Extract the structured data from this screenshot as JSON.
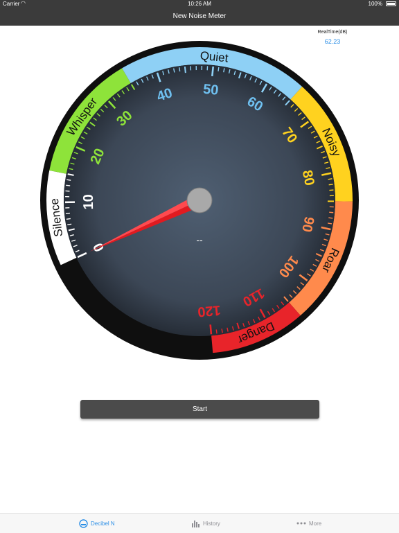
{
  "status_bar": {
    "carrier": "Carrier",
    "time": "10:26 AM",
    "battery": "100%"
  },
  "nav": {
    "title": "New Noise Meter"
  },
  "realtime": {
    "label": "RealTime(dB)",
    "value": "62.23"
  },
  "gauge": {
    "min": 0,
    "max": 120,
    "ticks": [
      "0",
      "10",
      "20",
      "30",
      "40",
      "50",
      "60",
      "70",
      "80",
      "90",
      "100",
      "110",
      "120"
    ],
    "zones": [
      {
        "label": "Silence",
        "from": 0,
        "to": 15,
        "color": "#ffffff",
        "text_color": "#111111"
      },
      {
        "label": "Whisper",
        "from": 15,
        "to": 35,
        "color": "#8ee33a",
        "text_color": "#111111"
      },
      {
        "label": "Quiet",
        "from": 35,
        "to": 65,
        "color": "#8ed0f5",
        "text_color": "#111111"
      },
      {
        "label": "Noisy",
        "from": 65,
        "to": 85,
        "color": "#ffd21f",
        "text_color": "#111111"
      },
      {
        "label": "Roar",
        "from": 85,
        "to": 105,
        "color": "#ff8a4c",
        "text_color": "#111111"
      },
      {
        "label": "Danger",
        "from": 105,
        "to": 120,
        "color": "#e8242a",
        "text_color": "#111111"
      }
    ],
    "number_colors": {
      "0": "#ffffff",
      "10": "#ffffff",
      "20": "#8ee33a",
      "30": "#8ee33a",
      "40": "#6fc0f0",
      "50": "#6fc0f0",
      "60": "#6fc0f0",
      "70": "#ffd21f",
      "80": "#ffd21f",
      "90": "#ff8a4c",
      "100": "#ff8a4c",
      "110": "#e8242a",
      "120": "#e8242a"
    },
    "needle_value": 0,
    "readout": "--"
  },
  "controls": {
    "start_label": "Start"
  },
  "tabs": [
    {
      "label": "Decibel N",
      "icon": "gauge-icon",
      "active": true
    },
    {
      "label": "History",
      "icon": "bar-chart-icon",
      "active": false
    },
    {
      "label": "More",
      "icon": "more-dots-icon",
      "active": false
    }
  ],
  "colors": {
    "accent": "#2a8ee6",
    "bar": "#3b3b3b",
    "needle": "#e11a20"
  }
}
